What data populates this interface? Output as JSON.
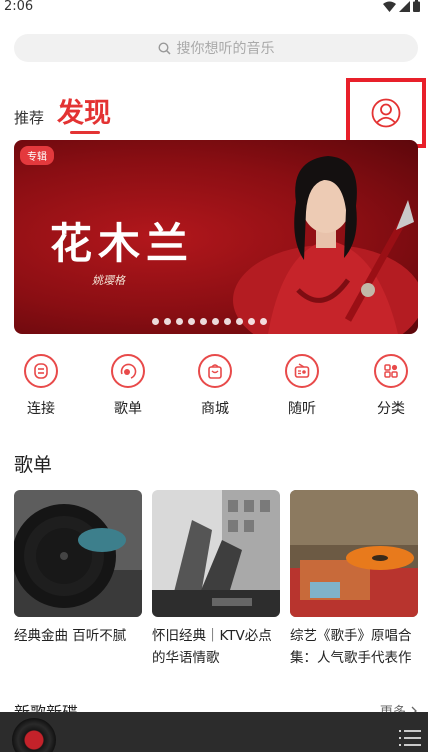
{
  "status_bar": {
    "time": "2:06"
  },
  "search": {
    "placeholder": "搜你想听的音乐"
  },
  "tabs": {
    "recommend": "推荐",
    "discover": "发现"
  },
  "banner": {
    "tag": "专辑",
    "title": "花木兰",
    "signature": "姚璎格",
    "dot_count": 10
  },
  "nav": [
    {
      "label": "连接",
      "icon": "connect-icon"
    },
    {
      "label": "歌单",
      "icon": "playlist-icon"
    },
    {
      "label": "商城",
      "icon": "shop-icon"
    },
    {
      "label": "随听",
      "icon": "radio-icon"
    },
    {
      "label": "分类",
      "icon": "category-icon"
    }
  ],
  "playlists_section": {
    "title": "歌单",
    "items": [
      {
        "line1": "经典金曲 百听不腻",
        "line2": ""
      },
      {
        "line1": "怀旧经典｜KTV必点",
        "line2": "的华语情歌"
      },
      {
        "line1": "综艺《歌手》原唱合",
        "line2": "集：人气歌手代表作"
      }
    ]
  },
  "new_releases": {
    "title": "新歌新碟",
    "more": "更多"
  },
  "colors": {
    "accent": "#e33333",
    "highlight_box": "#e8202a"
  }
}
